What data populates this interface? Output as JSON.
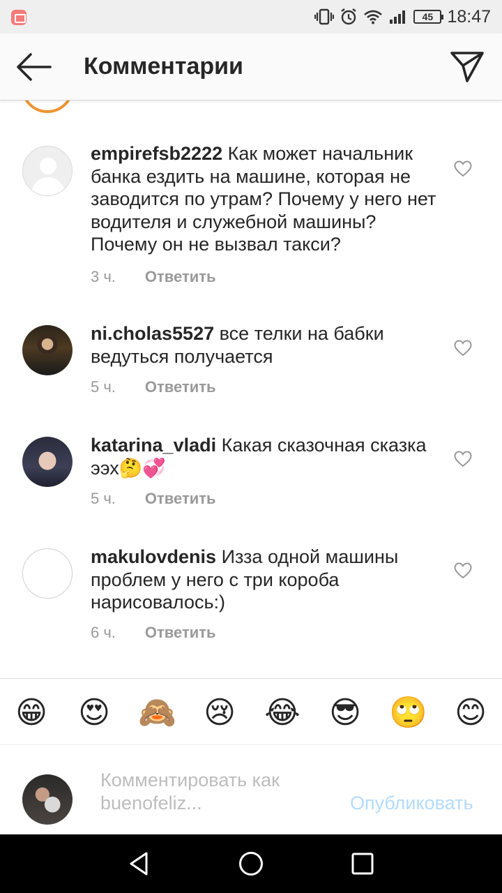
{
  "status_bar": {
    "battery": "45",
    "time": "18:47"
  },
  "header": {
    "title": "Комментарии"
  },
  "comments": [
    {
      "username": "empirefsb2222",
      "text": " Как может начальник банка ездить на машине, которая не заводится по утрам? Почему у него нет водителя и служебной машины? Почему он не вызвал такси?",
      "time": "3 ч.",
      "reply_label": "Ответить"
    },
    {
      "username": "ni.cholas5527",
      "text": " все телки на бабки ведуться получается",
      "time": "5 ч.",
      "reply_label": "Ответить"
    },
    {
      "username": "katarina_vladi",
      "text": " Какая сказочная сказка ээх🤔💞",
      "time": "5 ч.",
      "reply_label": "Ответить"
    },
    {
      "username": "makulovdenis",
      "text": " Изза одной машины проблем у него с три короба нарисовалось:)",
      "time": "6 ч.",
      "reply_label": "Ответить"
    }
  ],
  "emoji_bar": [
    "😁",
    "😍",
    "🙈",
    "😢",
    "😂",
    "😎",
    "🙄",
    "😊"
  ],
  "comment_input": {
    "placeholder": "Комментировать как buenofeliz...",
    "publish_label": "Опубликовать"
  }
}
